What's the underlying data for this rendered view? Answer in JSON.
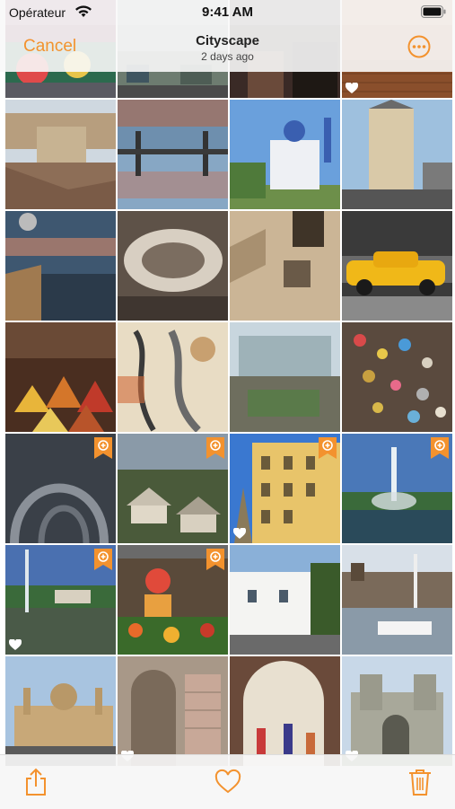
{
  "status_bar": {
    "carrier": "Opérateur",
    "time": "9:41 AM"
  },
  "nav": {
    "cancel_label": "Cancel",
    "title": "Cityscape",
    "subtitle": "2 days ago",
    "more_icon": "ellipsis-circle-icon"
  },
  "toolbar": {
    "share_icon": "share-icon",
    "favorite_icon": "heart-icon",
    "delete_icon": "trash-icon"
  },
  "accent_color": "#f3922e",
  "photos": [
    {
      "subject": "mosaic",
      "favorite": false,
      "shared": false
    },
    {
      "subject": "street market",
      "favorite": false,
      "shared": false
    },
    {
      "subject": "street interior",
      "favorite": false,
      "shared": false
    },
    {
      "subject": "brick pavement",
      "favorite": true,
      "shared": false
    },
    {
      "subject": "old town rooftops",
      "favorite": false,
      "shared": false
    },
    {
      "subject": "sunset bridge reflection",
      "favorite": false,
      "shared": false
    },
    {
      "subject": "blue domed cathedral",
      "favorite": false,
      "shared": false
    },
    {
      "subject": "corner building",
      "favorite": false,
      "shared": false
    },
    {
      "subject": "harbor at dusk",
      "favorite": false,
      "shared": false
    },
    {
      "subject": "spiral staircase",
      "favorite": false,
      "shared": false
    },
    {
      "subject": "stone lightwell",
      "favorite": false,
      "shared": false
    },
    {
      "subject": "yellow taxi",
      "favorite": false,
      "shared": false
    },
    {
      "subject": "spice market",
      "favorite": false,
      "shared": false
    },
    {
      "subject": "street art",
      "favorite": false,
      "shared": false
    },
    {
      "subject": "glass atrium",
      "favorite": false,
      "shared": false
    },
    {
      "subject": "love locks",
      "favorite": false,
      "shared": false
    },
    {
      "subject": "metal sculpture",
      "favorite": false,
      "shared": true
    },
    {
      "subject": "hillside village",
      "favorite": false,
      "shared": true
    },
    {
      "subject": "yellow facade",
      "favorite": true,
      "shared": true
    },
    {
      "subject": "fountain",
      "favorite": false,
      "shared": true
    },
    {
      "subject": "park fountain",
      "favorite": true,
      "shared": true
    },
    {
      "subject": "flower garden",
      "favorite": false,
      "shared": true
    },
    {
      "subject": "white village",
      "favorite": false,
      "shared": false
    },
    {
      "subject": "harbor boats",
      "favorite": false,
      "shared": false
    },
    {
      "subject": "basilica",
      "favorite": false,
      "shared": false
    },
    {
      "subject": "tiled facade",
      "favorite": true,
      "shared": false
    },
    {
      "subject": "moorish arch",
      "favorite": false,
      "shared": false
    },
    {
      "subject": "castle gate",
      "favorite": true,
      "shared": false
    }
  ]
}
